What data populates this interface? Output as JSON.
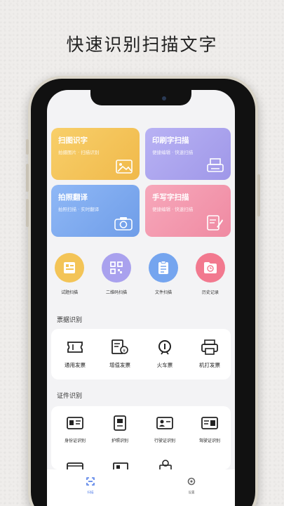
{
  "headline": "快速识别扫描文字",
  "cards": [
    {
      "title": "扫图识字",
      "subtitle": "拍摄图片 · 扫描识别",
      "icon": "image-icon",
      "color": "#f4c45a"
    },
    {
      "title": "印刷字扫描",
      "subtitle": "便捷编辑 · 快速扫描",
      "icon": "printer-icon",
      "color": "#aaa3ee"
    },
    {
      "title": "拍照翻译",
      "subtitle": "拍照扫描 · 实时翻译",
      "icon": "camera-icon",
      "color": "#7ea9ef"
    },
    {
      "title": "手写字扫描",
      "subtitle": "便捷编辑 · 快速扫描",
      "icon": "handwriting-icon",
      "color": "#f398ae"
    }
  ],
  "tools": [
    {
      "label": "试题扫描",
      "icon": "exam-scan-icon",
      "color": "#f3c457"
    },
    {
      "label": "二维码扫描",
      "icon": "qrcode-icon",
      "color": "#a9a1ee"
    },
    {
      "label": "文件扫描",
      "icon": "document-icon",
      "color": "#75a5ef"
    },
    {
      "label": "历史记录",
      "icon": "folder-clock-icon",
      "color": "#f2798f"
    }
  ],
  "sections": {
    "bills": {
      "title": "票据识别",
      "items": [
        {
          "label": "通用发票",
          "icon": "ticket-icon"
        },
        {
          "label": "增值发票",
          "icon": "vat-invoice-icon"
        },
        {
          "label": "火车票",
          "icon": "train-icon"
        },
        {
          "label": "机打发票",
          "icon": "printer-invoice-icon"
        }
      ]
    },
    "ids": {
      "title": "证件识别",
      "items": [
        {
          "label": "身份证识别",
          "icon": "id-card-icon"
        },
        {
          "label": "护照识别",
          "icon": "passport-icon"
        },
        {
          "label": "行驶证识别",
          "icon": "vehicle-license-icon"
        },
        {
          "label": "驾驶证识别",
          "icon": "driver-license-icon"
        }
      ]
    }
  },
  "tabbar": [
    {
      "label": "扫描",
      "icon": "scan-tab-icon",
      "active": true
    },
    {
      "label": "设置",
      "icon": "settings-tab-icon",
      "active": false
    }
  ],
  "colors": {
    "accent": "#4f7be8",
    "background": "#f3f3f5"
  }
}
